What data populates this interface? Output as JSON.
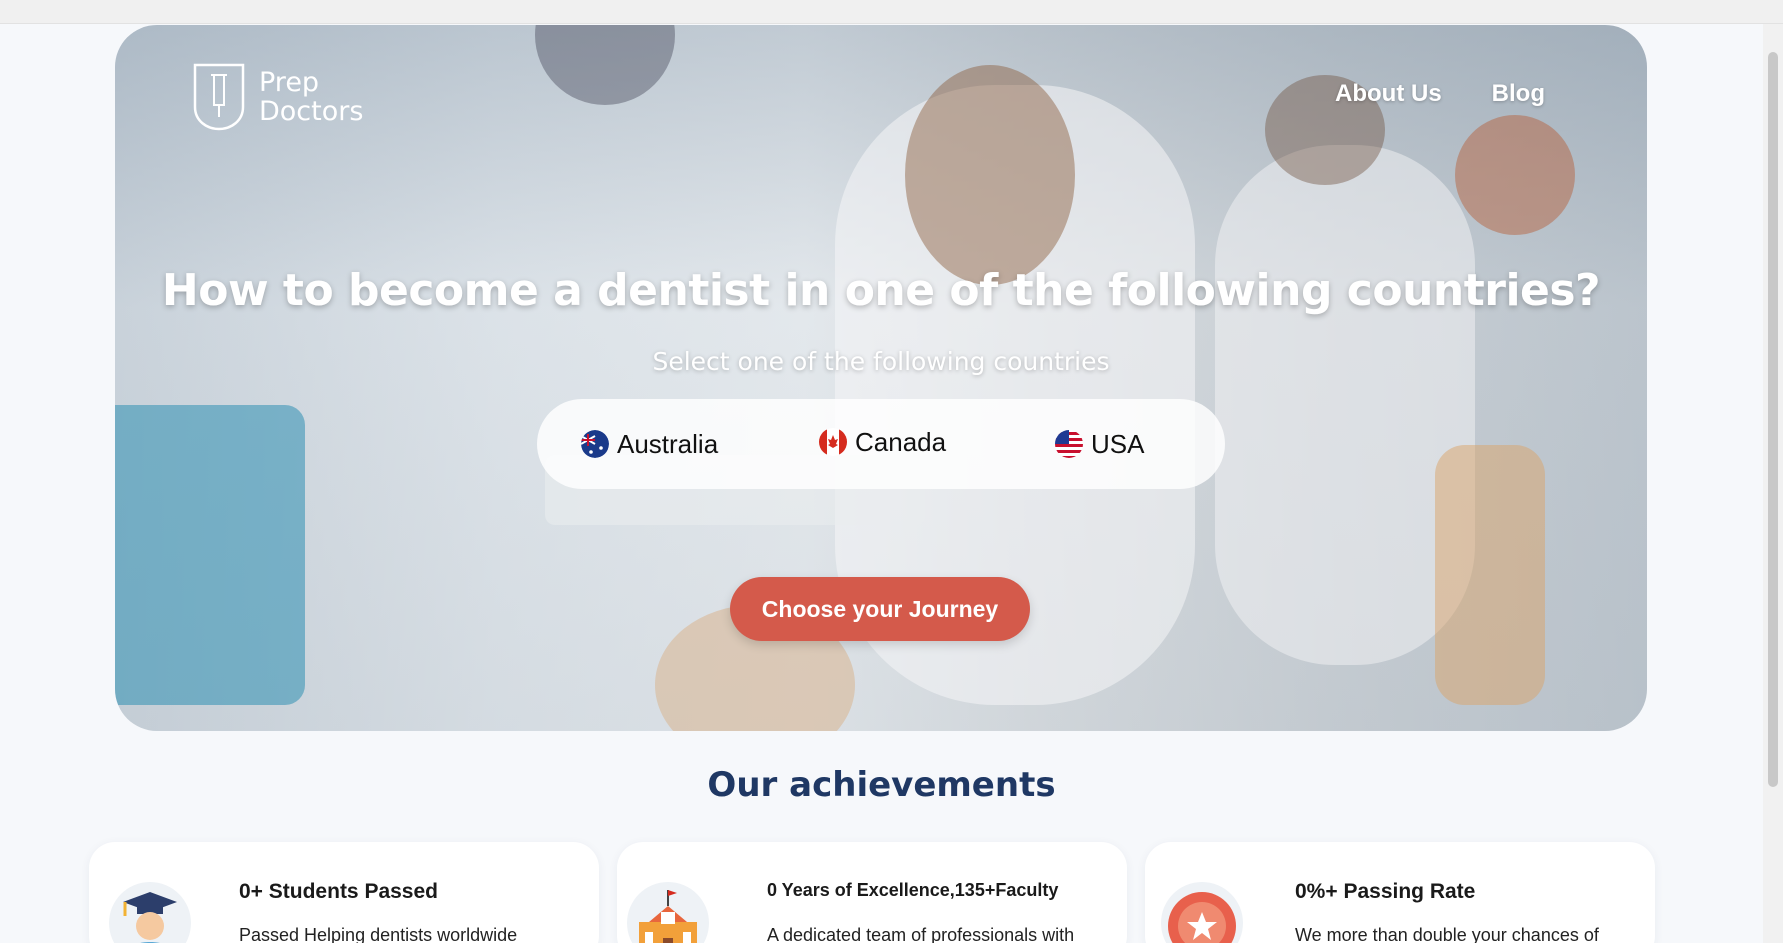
{
  "brand": {
    "logo_line1": "Prep",
    "logo_line2": "Doctors"
  },
  "nav": {
    "about": "About Us",
    "blog": "Blog"
  },
  "hero": {
    "title": "How to become a dentist in one of the following countries?",
    "subtitle": "Select one of the following countries",
    "countries": [
      {
        "label": "Australia",
        "flag": "australia-flag-icon"
      },
      {
        "label": "Canada",
        "flag": "canada-flag-icon"
      },
      {
        "label": "USA",
        "flag": "usa-flag-icon"
      }
    ],
    "cta": "Choose your Journey"
  },
  "achievements": {
    "title": "Our achievements",
    "cards": [
      {
        "title": "0+  Students Passed",
        "desc": "Passed Helping dentists worldwide",
        "icon": "graduate-icon"
      },
      {
        "title": "0 Years of Excellence,135+Faculty",
        "desc": "A dedicated team of professionals with",
        "icon": "school-building-icon"
      },
      {
        "title": "0%+ Passing Rate",
        "desc": "We more than double your chances of",
        "icon": "award-badge-icon"
      }
    ]
  },
  "colors": {
    "accent": "#d45a4b",
    "heading": "#1f3864",
    "background": "#f6f8fb"
  }
}
